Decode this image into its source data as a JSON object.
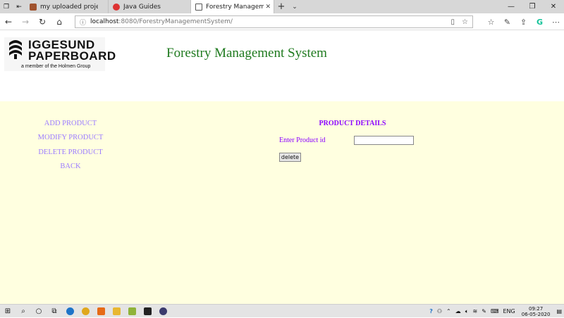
{
  "browser": {
    "tabs": [
      {
        "label": "my uploaded project list.do",
        "active": false
      },
      {
        "label": "Java Guides",
        "active": false
      },
      {
        "label": "Forestry Management S",
        "active": true
      }
    ],
    "url_host": "localhost",
    "url_path": ":8080/ForestryManagementSystem/"
  },
  "header": {
    "logo_line1": "IGGESUND",
    "logo_line2": "PAPERBOARD",
    "logo_tagline": "a member of the Holmen Group",
    "title": "Forestry Management System"
  },
  "menu": {
    "items": [
      "ADD PRODUCT",
      "MODIFY PRODUCT",
      "DELETE PRODUCT",
      "BACK"
    ]
  },
  "form": {
    "heading": "PRODUCT DETAILS",
    "field_label": "Enter Product id",
    "field_value": "",
    "submit_label": "delete"
  },
  "taskbar": {
    "language": "ENG",
    "time": "09:27",
    "date": "06-05-2020"
  },
  "colors": {
    "title_green": "#1f7a1f",
    "menu_link": "#9b7bff",
    "form_purple": "#8b00ff",
    "content_bg": "#ffffe0"
  }
}
